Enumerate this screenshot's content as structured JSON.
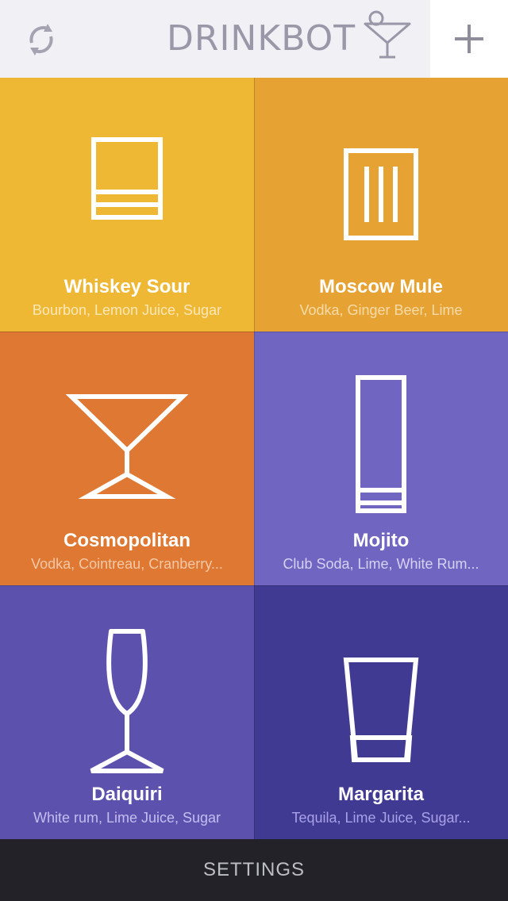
{
  "header": {
    "title": "DRINKBOT",
    "refresh_icon": "refresh-icon",
    "logo_icon": "cocktail-glass-icon",
    "add_icon": "plus-icon"
  },
  "drinks": [
    {
      "name": "Whiskey Sour",
      "ingredients": "Bourbon, Lemon Juice, Sugar",
      "color": "#eeb834",
      "sub_color": "#fbe7b8",
      "icon": "rocks-glass-icon"
    },
    {
      "name": "Moscow Mule",
      "ingredients": "Vodka, Ginger Beer, Lime",
      "color": "#e6a333",
      "sub_color": "#f6dba9",
      "icon": "mule-mug-icon"
    },
    {
      "name": "Cosmopolitan",
      "ingredients": "Vodka, Cointreau, Cranberry...",
      "color": "#df7832",
      "sub_color": "#f4c8a6",
      "icon": "martini-glass-icon"
    },
    {
      "name": "Mojito",
      "ingredients": "Club Soda, Lime, White Rum...",
      "color": "#7066c2",
      "sub_color": "#d6d2f2",
      "icon": "highball-glass-icon"
    },
    {
      "name": "Daiquiri",
      "ingredients": "White rum, Lime Juice, Sugar",
      "color": "#5c52ae",
      "sub_color": "#c3bdf0",
      "icon": "flute-glass-icon"
    },
    {
      "name": "Margarita",
      "ingredients": "Tequila, Lime Juice, Sugar...",
      "color": "#413a92",
      "sub_color": "#a8a1e8",
      "icon": "pint-glass-icon"
    }
  ],
  "footer": {
    "settings_label": "SETTINGS"
  }
}
